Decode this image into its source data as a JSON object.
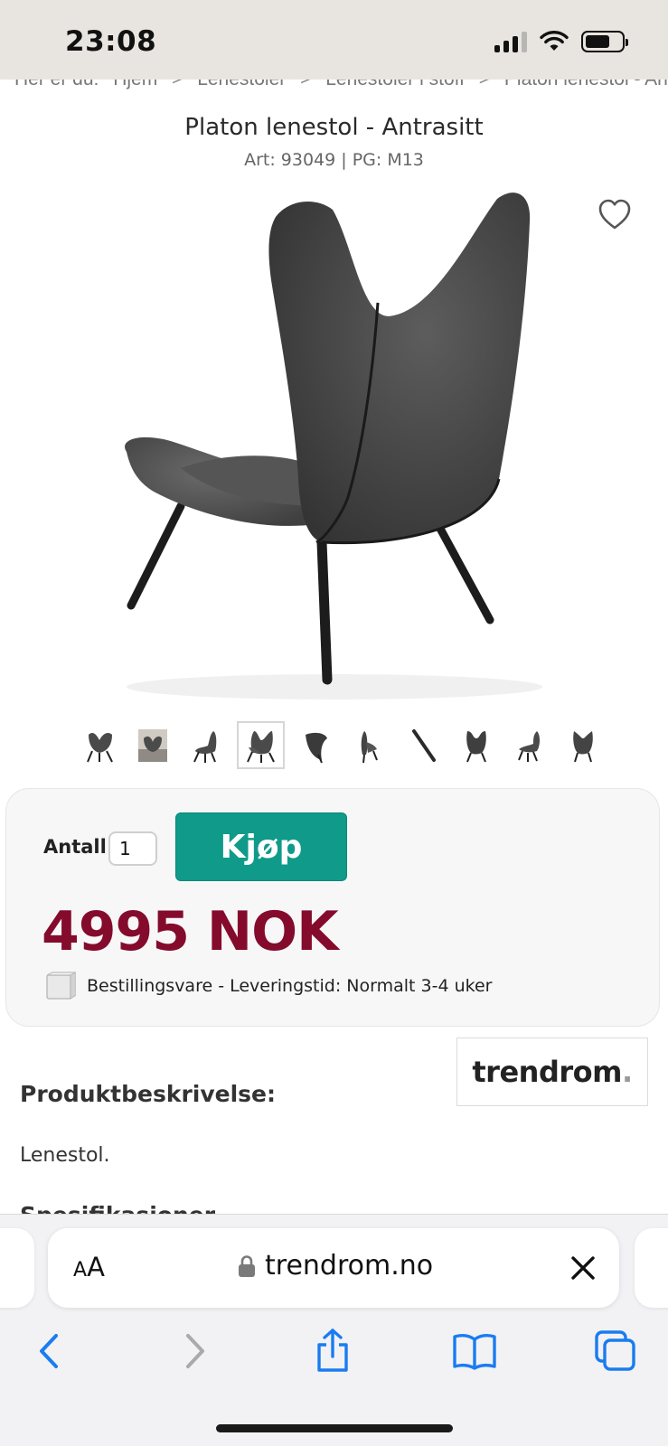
{
  "status_bar": {
    "time": "23:08"
  },
  "breadcrumb": {
    "prefix": "Her er du:",
    "items": [
      "Hjem",
      "Lenestoler",
      "Lenestoler i stoff",
      "Platon lenestol - Antrasitt"
    ],
    "separator": ">"
  },
  "product": {
    "title": "Platon lenestol - Antrasitt",
    "meta": "Art: 93049 | PG: M13",
    "thumbnail_count": 10,
    "active_thumbnail": 4
  },
  "purchase": {
    "quantity_label": "Antall:",
    "quantity_value": "1",
    "buy_label": "Kjøp",
    "price": "4995 NOK",
    "delivery": "Bestillingsvare - Leveringstid: Normalt 3-4 uker"
  },
  "brand": {
    "name": "trendrom",
    "dot": "."
  },
  "description": {
    "heading": "Produktbeskrivelse:",
    "text": "Lenestol.",
    "spec_heading": "Spesifikasjoner"
  },
  "browser": {
    "aa_small": "A",
    "aa_big": "A",
    "url": "trendrom.no"
  },
  "colors": {
    "accent": "#0f9a8a",
    "price": "#840b2c",
    "ios_blue": "#1a7cf0"
  },
  "icons": [
    "heart-icon",
    "lock-icon",
    "close-icon",
    "back-icon",
    "forward-icon",
    "share-icon",
    "bookmarks-icon",
    "tabs-icon"
  ]
}
